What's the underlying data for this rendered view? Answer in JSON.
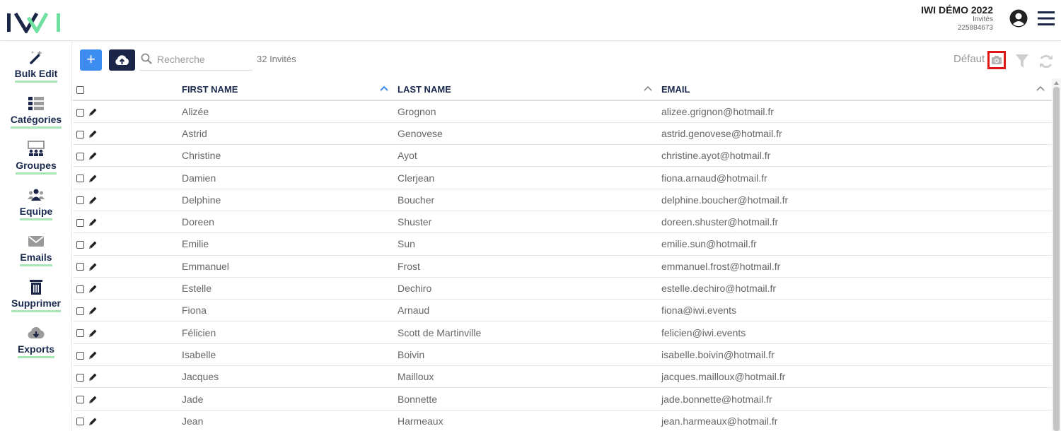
{
  "header": {
    "event_title": "IWI DÉMO 2022",
    "event_subtitle": "Invités",
    "event_code": "225884673"
  },
  "sidebar": {
    "items": [
      {
        "label": "Bulk Edit",
        "icon": "magic-wand-icon"
      },
      {
        "label": "Catégories",
        "icon": "list-icon"
      },
      {
        "label": "Groupes",
        "icon": "group-board-icon"
      },
      {
        "label": "Equipe",
        "icon": "team-icon"
      },
      {
        "label": "Emails",
        "icon": "envelope-icon"
      },
      {
        "label": "Supprimer",
        "icon": "trash-icon"
      },
      {
        "label": "Exports",
        "icon": "cloud-download-icon"
      }
    ]
  },
  "toolbar": {
    "add_label": "+",
    "search_placeholder": "Recherche",
    "count_label": "32 Invités",
    "view_label": "Défaut"
  },
  "table": {
    "columns": [
      "FIRST NAME",
      "LAST NAME",
      "EMAIL"
    ],
    "rows": [
      [
        "Alizée",
        "Grognon",
        "alizee.grignon@hotmail.fr"
      ],
      [
        "Astrid",
        "Genovese",
        "astrid.genovese@hotmail.fr"
      ],
      [
        "Christine",
        "Ayot",
        "christine.ayot@hotmail.fr"
      ],
      [
        "Damien",
        "Clerjean",
        "fiona.arnaud@hotmail.fr"
      ],
      [
        "Delphine",
        "Boucher",
        "delphine.boucher@hotmail.fr"
      ],
      [
        "Doreen",
        "Shuster",
        "doreen.shuster@hotmail.fr"
      ],
      [
        "Emilie",
        "Sun",
        "emilie.sun@hotmail.fr"
      ],
      [
        "Emmanuel",
        "Frost",
        "emmanuel.frost@hotmail.fr"
      ],
      [
        "Estelle",
        "Dechiro",
        "estelle.dechiro@hotmail.fr"
      ],
      [
        "Fiona",
        "Arnaud",
        "fiona@iwi.events"
      ],
      [
        "Félicien",
        "Scott de Martinville",
        "felicien@iwi.events"
      ],
      [
        "Isabelle",
        "Boivin",
        "isabelle.boivin@hotmail.fr"
      ],
      [
        "Jacques",
        "Mailloux",
        "jacques.mailloux@hotmail.fr"
      ],
      [
        "Jade",
        "Bonnette",
        "jade.bonnette@hotmail.fr"
      ],
      [
        "Jean",
        "Harmeaux",
        "jean.harmeaux@hotmail.fr"
      ]
    ]
  },
  "colors": {
    "accent_blue": "#3d8cf0",
    "navy": "#1b2548",
    "label_underline": "#a8e6b6",
    "highlight_red": "#e01616"
  }
}
